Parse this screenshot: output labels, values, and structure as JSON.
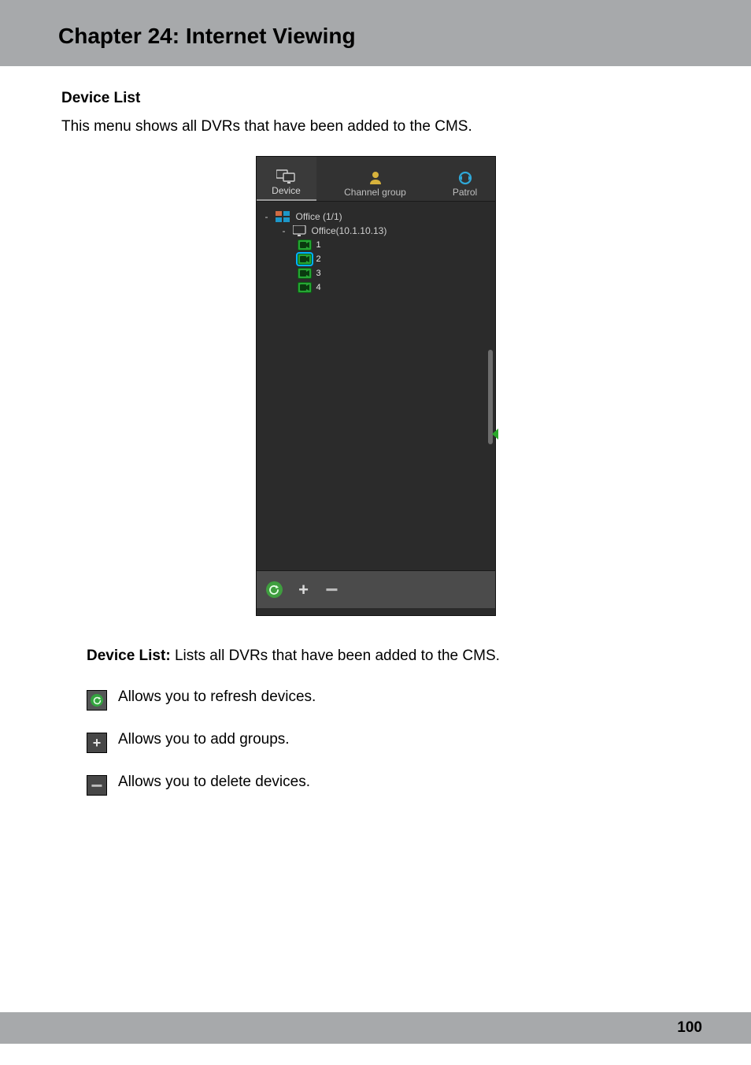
{
  "header": {
    "title": "Chapter 24: Internet Viewing"
  },
  "section": {
    "heading": "Device List",
    "intro": "This menu shows all DVRs that have been added to the CMS."
  },
  "panel": {
    "tabs": {
      "device": "Device",
      "channelGroup": "Channel group",
      "patrol": "Patrol"
    },
    "tree": {
      "group": {
        "label": "Office (1/1)",
        "device": {
          "label": "Office(10.1.10.13)",
          "channels": [
            "1",
            "2",
            "3",
            "4"
          ]
        }
      }
    },
    "actions": {
      "refresh": "refresh",
      "add": "add",
      "remove": "remove"
    }
  },
  "descriptions": {
    "deviceListLabel": "Device List:",
    "deviceListText": " Lists all DVRs that have been added to the CMS.",
    "refreshText": " Allows you to refresh devices.",
    "addText": " Allows you to add groups.",
    "deleteText": " Allows you to delete devices."
  },
  "footer": {
    "pageNumber": "100"
  }
}
